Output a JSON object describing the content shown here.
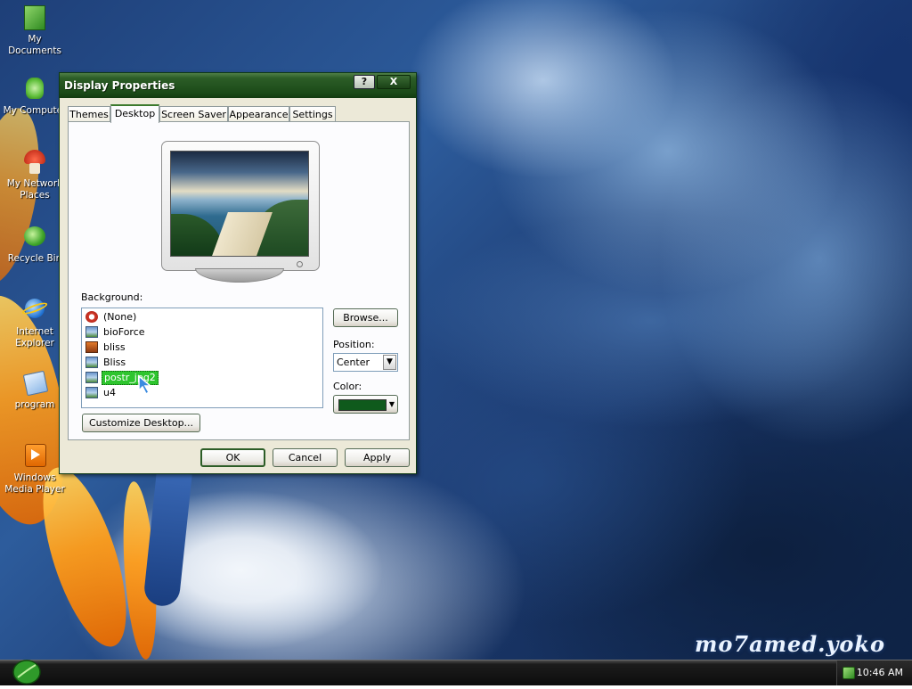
{
  "desktop": {
    "icons": [
      {
        "label": "My Documents",
        "name": "my-documents-icon"
      },
      {
        "label": "My Computer",
        "name": "my-computer-icon"
      },
      {
        "label": "My Network Places",
        "name": "my-network-places-icon"
      },
      {
        "label": "Recycle Bin",
        "name": "recycle-bin-icon"
      },
      {
        "label": "Internet Explorer",
        "name": "internet-explorer-icon"
      },
      {
        "label": "program",
        "name": "folder-icon"
      },
      {
        "label": "Windows Media Player",
        "name": "windows-media-player-icon"
      }
    ],
    "signature": "mo7amed.yoko"
  },
  "dialog": {
    "title": "Display Properties",
    "help_button": "?",
    "close_button": "X",
    "tabs": [
      {
        "label": "Themes",
        "active": false
      },
      {
        "label": "Desktop",
        "active": true
      },
      {
        "label": "Screen Saver",
        "active": false
      },
      {
        "label": "Appearance",
        "active": false
      },
      {
        "label": "Settings",
        "active": false
      }
    ],
    "background_label": "Background:",
    "background_items": [
      {
        "label": "(None)",
        "icon": "none-icon",
        "selected": false
      },
      {
        "label": "bioForce",
        "icon": "image-file-icon",
        "selected": false
      },
      {
        "label": "bliss",
        "icon": "image-file-icon",
        "selected": false
      },
      {
        "label": "Bliss",
        "icon": "image-file-icon",
        "selected": false
      },
      {
        "label": "postr_jpg2",
        "icon": "image-file-icon",
        "selected": true
      },
      {
        "label": "u4",
        "icon": "image-file-icon",
        "selected": false
      }
    ],
    "browse_button": "Browse...",
    "position_label": "Position:",
    "position_value": "Center",
    "color_label": "Color:",
    "color_value": "#0f5a1c",
    "customize_button": "Customize Desktop...",
    "ok_button": "OK",
    "cancel_button": "Cancel",
    "apply_button": "Apply"
  },
  "taskbar": {
    "clock": "10:46 AM"
  },
  "colors": {
    "accent": "#2c5d27",
    "selection": "#2ec52e"
  }
}
